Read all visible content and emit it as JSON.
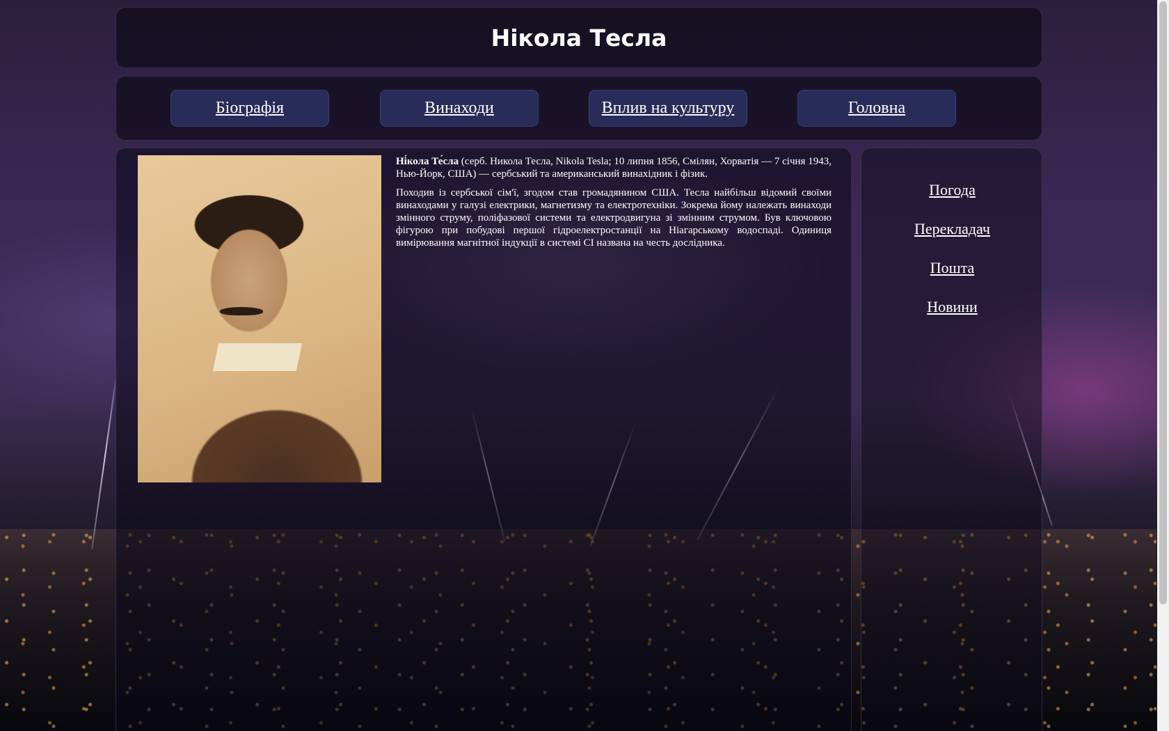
{
  "header": {
    "title": "Нікола Тесла"
  },
  "nav": {
    "items": [
      {
        "label": "Біографія"
      },
      {
        "label": "Винаходи"
      },
      {
        "label": "Вплив на культуру"
      },
      {
        "label": "Головна"
      }
    ]
  },
  "main": {
    "portrait_alt": "Нікола Тесла",
    "intro_name": "Ні́кола Те́сла",
    "intro_rest": " (серб. Никола Тесла, Nikola Tesla; 10 липня 1856, Смілян, Хорватія — 7 січня 1943, Нью-Йорк, США) — сербський та американський винахідник і фізик.",
    "paragraph2": "Походив із сербської сім'ї, згодом став громадянином США. Тесла найбільш відомий своїми винаходами у галузі електрики, магнетизму та електротехніки. Зокрема йому належать винаходи змінного струму, поліфазової системи та електродвигуна зі змінним струмом. Був ключовою фігурою при побудові першої гідроелектростанції на Ніагарському водоспаді. Одиниця вимірювання магнітної індукції в системі СІ названа на честь дослідника."
  },
  "sidebar": {
    "links": [
      {
        "label": "Погода"
      },
      {
        "label": "Перекладач"
      },
      {
        "label": "Пошта"
      },
      {
        "label": "Новини"
      }
    ]
  }
}
